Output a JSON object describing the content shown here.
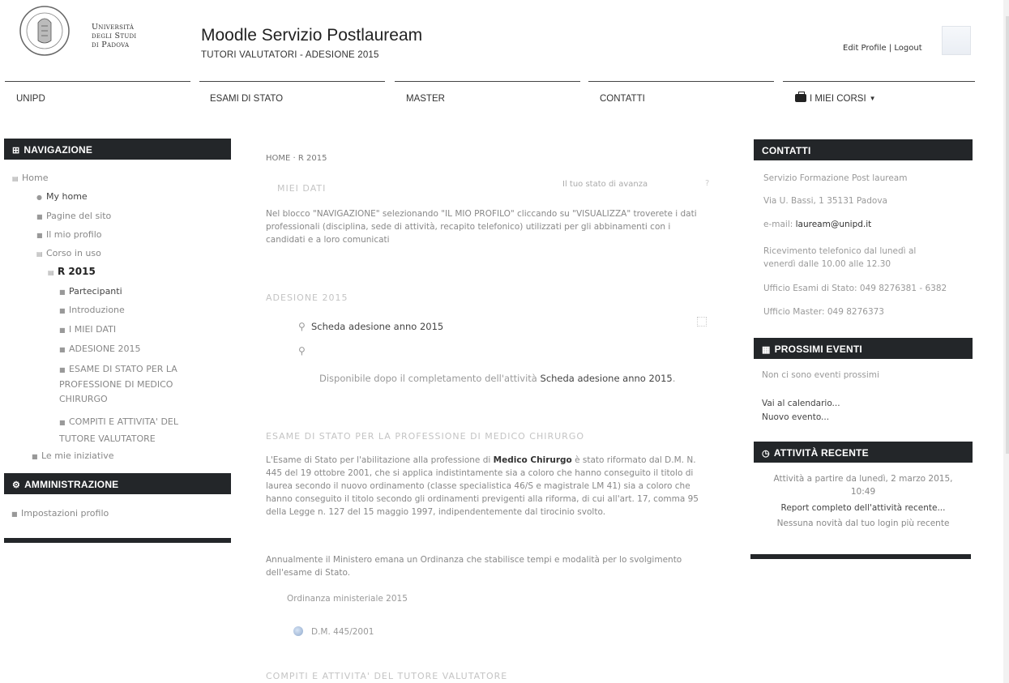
{
  "header": {
    "university": [
      "Università",
      "degli Studi",
      "di Padova"
    ],
    "site_title": "Moodle Servizio Postlauream",
    "site_subtitle": "TUTORI VALUTATORI - ADESIONE 2015",
    "edit_profile": "Edit Profile",
    "separator": "|",
    "logout": "Logout"
  },
  "topnav": {
    "items": [
      "UNIPD",
      "ESAMI DI STATO",
      "MASTER",
      "CONTATTI",
      "I MIEI CORSI"
    ]
  },
  "navigation": {
    "title": "NAVIGAZIONE",
    "items": [
      {
        "label": "Home"
      },
      {
        "label": "My home"
      },
      {
        "label": "Pagine del sito"
      },
      {
        "label": "Il mio profilo"
      },
      {
        "label": "Corso in uso"
      },
      {
        "label": "R 2015"
      },
      {
        "label": "Partecipanti"
      },
      {
        "label": "Introduzione"
      },
      {
        "label": "I MIEI DATI"
      },
      {
        "label": "ADESIONE 2015"
      },
      {
        "label": "ESAME DI STATO PER LA",
        "line2": "PROFESSIONE DI MEDICO",
        "line3": "CHIRURGO"
      },
      {
        "label": "COMPITI E ATTIVITA' DEL",
        "line2": "TUTORE VALUTATORE"
      },
      {
        "label": "Le mie iniziative"
      }
    ]
  },
  "administration": {
    "title": "AMMINISTRAZIONE",
    "items": [
      "Impostazioni profilo"
    ]
  },
  "main": {
    "breadcrumb": "HOME · R 2015",
    "section1_title": "MIEI DATI",
    "progress_label": "Il tuo stato di avanza",
    "help": "?",
    "section1_text": "Nel blocco \"NAVIGAZIONE\" selezionando \"IL MIO PROFILO\" cliccando su \"VISUALIZZA\" troverete i dati professionali (disciplina, sede di attività, recapito telefonico) utilizzati per gli abbinamenti con i candidati e a loro comunicati",
    "section2_title": "ADESIONE 2015",
    "activity1": "Scheda adesione anno 2015",
    "avail_prefix": "Disponibile dopo il completamento dell'attività ",
    "avail_activity": "Scheda adesione anno 2015",
    "avail_suffix": ".",
    "section3_title": "ESAME DI STATO PER LA PROFESSIONE DI MEDICO CHIRURGO",
    "section3_p1_a": "L'Esame di Stato per l'abilitazione alla professione di ",
    "section3_p1_b": "Medico Chirurgo",
    "section3_p1_c": " è stato riformato dal D.M. N. 445 del 19 ottobre 2001, che si applica indistintamente sia a coloro che hanno conseguito il titolo di laurea secondo il nuovo ordinamento (classe specialistica 46/S e magistrale LM 41) sia a coloro che hanno conseguito il titolo secondo gli ordinamenti previgenti alla riforma, di cui all'art. 17, comma 95 della Legge n. 127 del 15 maggio 1997, indipendentemente dal tirocinio svolto.",
    "section3_p2": "Annualmente il Ministero emana un Ordinanza che stabilisce tempi e modalità per lo svolgimento dell'esame di Stato.",
    "ordinanza": "Ordinanza ministeriale 2015",
    "dm": "D.M. 445/2001",
    "section4_title": "COMPITI E ATTIVITA' DEL TUTORE VALUTATORE"
  },
  "contatti": {
    "title": "CONTATTI",
    "lines": [
      "Servizio Formazione Post lauream",
      "Via U. Bassi, 1 35131 Padova",
      "e-mail: ",
      "Ricevimento telefonico dal lunedì al",
      "venerdì dalle 10.00 alle 12.30",
      "Ufficio Esami di Stato: 049 8276381 - 6382",
      "Ufficio Master: 049 8276373"
    ],
    "email": "lauream@unipd.it"
  },
  "eventi": {
    "title": "PROSSIMI EVENTI",
    "none": "Non ci sono eventi prossimi",
    "calendar": "Vai al calendario...",
    "new_event": "Nuovo evento..."
  },
  "recent": {
    "title": "ATTIVITÀ RECENTE",
    "since": "Attività a partire da lunedì, 2 marzo 2015,",
    "time": "10:49",
    "report": "Report completo dell'attività recente...",
    "none": "Nessuna novità dal tuo login più recente"
  },
  "colors": {
    "block_header": "#232629",
    "text_muted": "#999999"
  }
}
